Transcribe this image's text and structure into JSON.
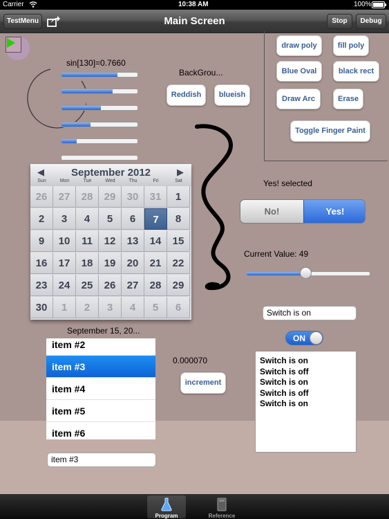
{
  "status": {
    "carrier": "Carrier",
    "time": "10:38 AM",
    "battery": "100%"
  },
  "nav": {
    "title": "Main Screen",
    "left_button": "TestMenu",
    "share_icon": "share-icon",
    "stop": "Stop",
    "debug": "Debug"
  },
  "canvas": {
    "sin_label": "sin[130]=0.7660"
  },
  "sliders": [
    0.74,
    0.67,
    0.52,
    0.38,
    0.2,
    0.0
  ],
  "background": {
    "label": "BackGrou...",
    "reddish": "Reddish",
    "blueish": "blueish"
  },
  "draw_panel": {
    "draw_poly": "draw poly",
    "fill_poly": "fill poly",
    "blue_oval": "Blue Oval",
    "black_rect": "black rect",
    "draw_arc": "Draw Arc",
    "erase": "Erase",
    "toggle_finger": "Toggle Finger Paint"
  },
  "calendar": {
    "month": "September 2012",
    "prev": "◀",
    "next": "▶",
    "dow": [
      "Sun",
      "Mon",
      "Tue",
      "Wed",
      "Thu",
      "Fri",
      "Sat"
    ],
    "weeks": [
      [
        "26",
        "27",
        "28",
        "29",
        "30",
        "31",
        "1"
      ],
      [
        "2",
        "3",
        "4",
        "5",
        "6",
        "7",
        "8"
      ],
      [
        "9",
        "10",
        "11",
        "12",
        "13",
        "14",
        "15"
      ],
      [
        "16",
        "17",
        "18",
        "19",
        "20",
        "21",
        "22"
      ],
      [
        "23",
        "24",
        "25",
        "26",
        "27",
        "28",
        "29"
      ],
      [
        "30",
        "1",
        "2",
        "3",
        "4",
        "5",
        "6"
      ]
    ],
    "selected": "7",
    "date_label": "September  15, 20..."
  },
  "segmented": {
    "status": "Yes! selected",
    "no": "No!",
    "yes": "Yes!",
    "selected": "Yes!"
  },
  "value_slider": {
    "label": "Current Value:  49",
    "value": 49,
    "min": 0,
    "max": 100
  },
  "switch_area": {
    "field": "Switch is on",
    "toggle": "ON",
    "log": [
      "Switch is on",
      "Switch is off",
      "Switch is on",
      "Switch is off",
      "Switch is on"
    ]
  },
  "list": {
    "items": [
      "item #2",
      "item #3",
      "item #4",
      "item #5",
      "item #6"
    ],
    "selected": "item #3",
    "field": "item #3"
  },
  "counter": {
    "value": "0.000070",
    "increment": "increment"
  },
  "tabs": [
    {
      "label": "Program",
      "icon": "flask-icon"
    },
    {
      "label": "Reference",
      "icon": "book-icon"
    }
  ]
}
